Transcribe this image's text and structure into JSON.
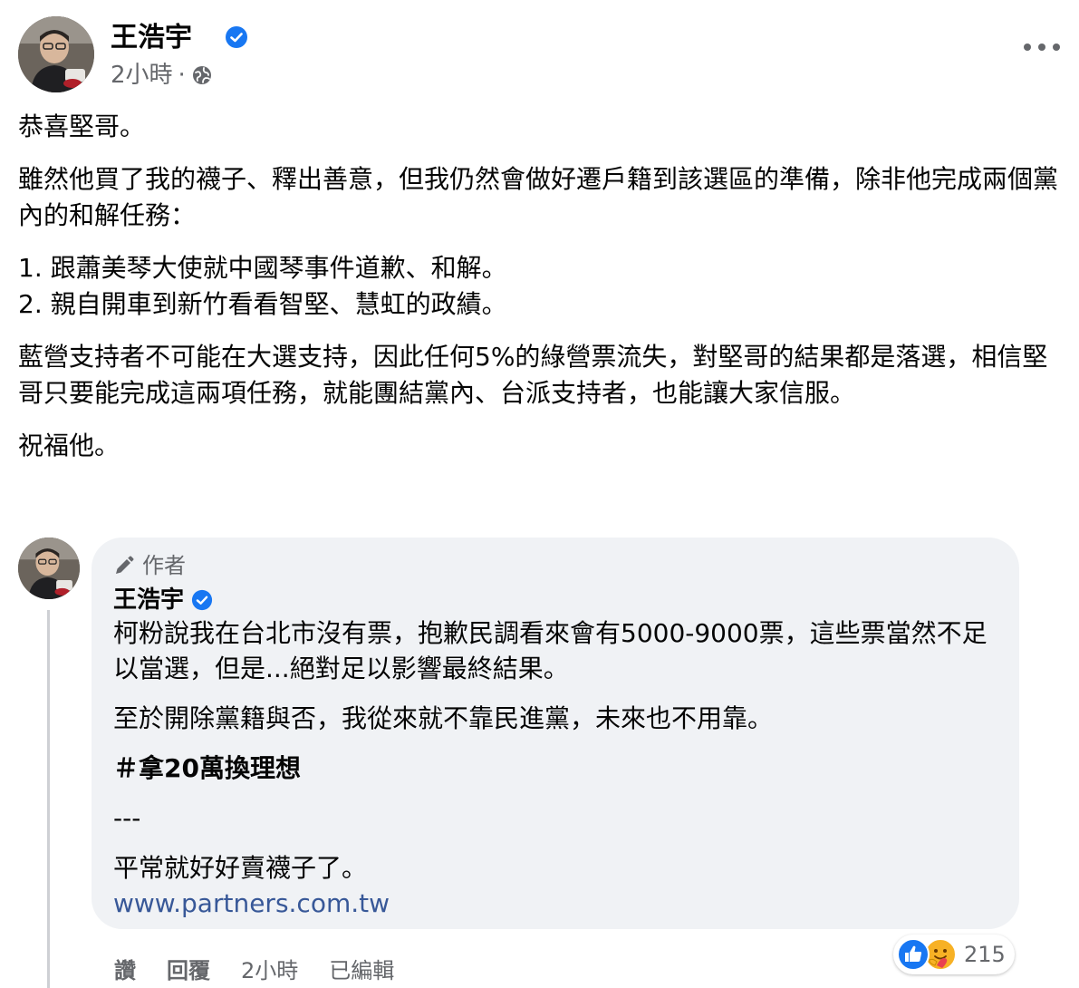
{
  "post": {
    "author": "王浩宇",
    "time": "2小時",
    "separator": "·",
    "paragraphs": {
      "p1": "恭喜堅哥。",
      "p2": "雖然他買了我的襪子、釋出善意，但我仍然會做好遷戶籍到該選區的準備，除非他完成兩個黨內的和解任務：",
      "item1": "1. 跟蕭美琴大使就中國琴事件道歉、和解。",
      "item2": "2. 親自開車到新竹看看智堅、慧虹的政績。",
      "p3": "藍營支持者不可能在大選支持，因此任何5%的綠營票流失，對堅哥的結果都是落選，相信堅哥只要能完成這兩項任務，就能團結黨內、台派支持者，也能讓大家信服。",
      "p4": "祝福他。"
    }
  },
  "comment": {
    "badge": "作者",
    "author": "王浩宇",
    "line1": "柯粉說我在台北市沒有票，抱歉民調看來會有5000-9000票，這些票當然不足以當選，但是...絕對足以影響最終結果。",
    "line2": "至於開除黨籍與否，我從來就不靠民進黨，未來也不用靠。",
    "hashtag": "＃拿20萬換理想",
    "divider": "---",
    "line3": "平常就好好賣襪子了。",
    "link": "www.partners.com.tw",
    "reaction_count": "215",
    "actions": {
      "like": "讚",
      "reply": "回覆",
      "time": "2小時",
      "edited": "已編輯"
    }
  },
  "colors": {
    "verified": "#1877f2",
    "secondary_text": "#65676b",
    "bubble_bg": "#f0f2f5",
    "link": "#385898"
  },
  "icons": [
    "verified-icon",
    "globe-icon",
    "more-icon",
    "pencil-icon",
    "like-reaction-icon",
    "care-reaction-icon"
  ]
}
